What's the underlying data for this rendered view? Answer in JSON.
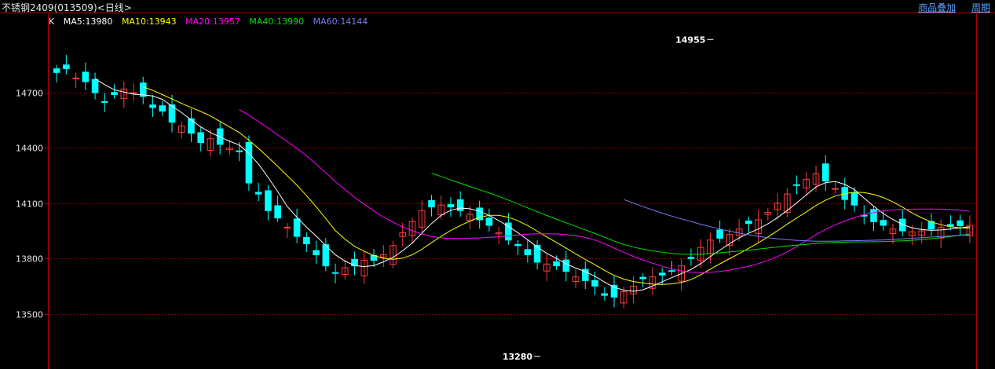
{
  "header": {
    "title": "不锈钢2409(013509)<日线>",
    "links": [
      "商品叠加",
      "周期"
    ]
  },
  "legend": {
    "k_label": "K",
    "items": [
      {
        "text": "MA5:13980",
        "color": "#ffffff"
      },
      {
        "text": "MA10:13943",
        "color": "#ffff00"
      },
      {
        "text": "MA20:13957",
        "color": "#ff00ff"
      },
      {
        "text": "MA40:13990",
        "color": "#00e000"
      },
      {
        "text": "MA60:14144",
        "color": "#7b7bff"
      }
    ]
  },
  "colors": {
    "up": "#ff3c3c",
    "down": "#00ffff",
    "grid": "#8b0000",
    "axis": "#b40000",
    "ma5": "#ffffff",
    "ma10": "#ffff00",
    "ma20": "#ff00ff",
    "ma40": "#00e000",
    "ma60": "#7b7bff"
  },
  "chart_data": {
    "type": "candlestick",
    "ylim": [
      13200,
      15050
    ],
    "yticks": [
      13500,
      13800,
      14100,
      14400,
      14700
    ],
    "grid": true,
    "annotations": [
      {
        "text": "14955",
        "bar": 68,
        "value": 14955,
        "position": "above"
      },
      {
        "text": "13280",
        "bar": 50,
        "value": 13280,
        "position": "below"
      }
    ],
    "closes": [
      14810,
      14830,
      14780,
      14760,
      14700,
      14650,
      14690,
      14720,
      14700,
      14680,
      14620,
      14600,
      14540,
      14520,
      14480,
      14430,
      14450,
      14420,
      14400,
      14380,
      14210,
      14150,
      14060,
      14020,
      13970,
      13920,
      13880,
      13820,
      13760,
      13720,
      13750,
      13760,
      13790,
      13790,
      13820,
      13870,
      13940,
      14000,
      14060,
      14080,
      14090,
      14080,
      14060,
      14040,
      14010,
      13980,
      13940,
      13900,
      13870,
      13820,
      13780,
      13770,
      13760,
      13730,
      13700,
      13680,
      13650,
      13600,
      13590,
      13620,
      13650,
      13690,
      13700,
      13710,
      13730,
      13760,
      13800,
      13860,
      13900,
      13910,
      13930,
      13960,
      13990,
      14010,
      14050,
      14100,
      14150,
      14200,
      14230,
      14260,
      14220,
      14180,
      14120,
      14090,
      14030,
      14000,
      13980,
      13960,
      13950,
      13945,
      13950,
      13960,
      13970,
      13975,
      13978,
      13980
    ]
  }
}
